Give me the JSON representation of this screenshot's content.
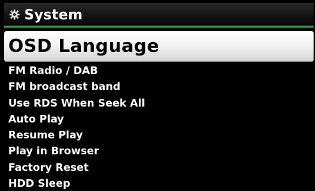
{
  "header": {
    "icon": "gear-icon",
    "title": "System",
    "accent_color": "#2f9a4a"
  },
  "selected_item": {
    "label": "OSD Language"
  },
  "menu_items": [
    "FM Radio / DAB",
    "FM broadcast band",
    "Use RDS When Seek All",
    "Auto Play",
    "Resume Play",
    "Play in Browser",
    "Factory Reset",
    "HDD Sleep"
  ]
}
